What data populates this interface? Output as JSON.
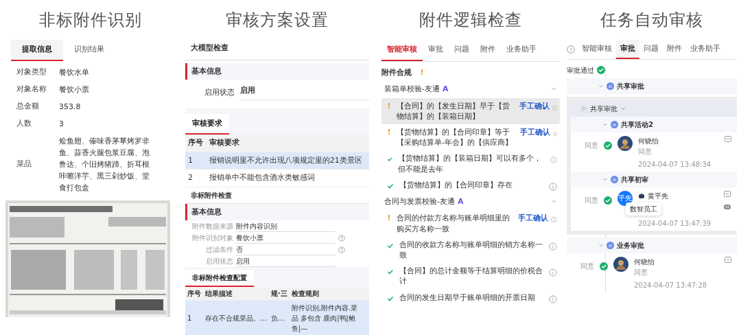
{
  "headings": [
    "非标附件识别",
    "审核方案设置",
    "附件逻辑检查",
    "任务自动审核"
  ],
  "extraction": {
    "tabs": [
      {
        "label": "提取信息",
        "selected": true
      },
      {
        "label": "识别结果",
        "selected": false
      }
    ],
    "fields": [
      {
        "label": "对象类型",
        "value": "餐饮水单"
      },
      {
        "label": "对象名称",
        "value": "餐饮小票"
      },
      {
        "label": "总金额",
        "value": "353.8"
      },
      {
        "label": "人数",
        "value": "3"
      },
      {
        "label": "菜品",
        "value": "烩鱼翅、傣味香茅草烤罗非鱼、蒜香火腿包浆豆腐、泡鲁达、个旧烤猪蹄、折耳根咔嚓洋芋、黑三剁炒饭、堂食打包盒"
      }
    ]
  },
  "scheme": {
    "title": "大模型检查",
    "section": "基本信息",
    "fields": [
      {
        "label": "启用状态",
        "value": "启用"
      }
    ],
    "tab": "审核要求",
    "columns": [
      "序号",
      "审核要求"
    ],
    "rows": [
      {
        "cells": [
          "1",
          "报销说明里不允许出现八项规定里的21类景区"
        ],
        "selected": true
      },
      {
        "cells": [
          "2",
          "报销单中不能包含酒水类敏感词"
        ],
        "selected": false
      }
    ],
    "sub_title": "非标附件检查",
    "sub_section": "基本信息",
    "sub_fields": [
      {
        "label": "附件数据来源",
        "value": "附件内容识别"
      },
      {
        "label": "附件识别对象",
        "value": "餐饮小票",
        "help": true
      },
      {
        "label": "过滤条件",
        "value": "否",
        "help": true
      },
      {
        "label": "启用状态",
        "value": "启用"
      }
    ],
    "sub_tab": "非标附件检查配置",
    "sub_columns": [
      "序号",
      "结果描述",
      "规·三",
      "检查规则"
    ],
    "sub_rows": [
      {
        "cells": [
          "1",
          "存在不合规菜品。…",
          "负…",
          "附件识别,附件内容.菜品 多包含 鹿肉|鸭|鲍鱼|—"
        ],
        "selected": true
      }
    ]
  },
  "logic": {
    "tabs": [
      {
        "label": "智能审核",
        "selected": true
      },
      {
        "label": "审批",
        "selected": false
      },
      {
        "label": "问题",
        "selected": false
      },
      {
        "label": "附件",
        "selected": false
      },
      {
        "label": "业务助手",
        "selected": false
      }
    ],
    "section": "附件合规",
    "section_mark": "!",
    "groups": [
      {
        "name": "装箱单校验-友通",
        "ai": "A",
        "items": [
          {
            "kind": "warn",
            "mark": "!",
            "text": "【合同】的【发生日期】早于【货物结算】的【装箱日期】",
            "action": "手工确认",
            "highlighted": true
          },
          {
            "kind": "warn",
            "mark": "!",
            "text": "【货物结算】的【合同印章】等于【采购结算单-年会】的【供应商】",
            "action": "手工确认",
            "highlighted": false
          },
          {
            "kind": "ok",
            "text": "【货物结算】的【装箱日期】可以有多个，但不能是去年",
            "highlighted": false
          },
          {
            "kind": "ok",
            "text": "【货物结算】的【合同印章】存在",
            "highlighted": false
          }
        ]
      },
      {
        "name": "合同与发票校验-友通",
        "ai": "A",
        "items": [
          {
            "kind": "warn",
            "mark": "!",
            "text": "合同的付款方名称与账单明细里的购买方名称一致",
            "action": "手工确认",
            "highlighted": false
          },
          {
            "kind": "ok",
            "text": "合同的收款方名称与账单明细的销方名称一致",
            "highlighted": false
          },
          {
            "kind": "ok",
            "text": "【合同】的总计金额等于结算明细的价税合计",
            "highlighted": false
          },
          {
            "kind": "ok",
            "text": "合同的发生日期早于账单明细的开票日期",
            "highlighted": false
          }
        ]
      }
    ]
  },
  "approval": {
    "tabs": [
      {
        "label": "智能审核",
        "selected": false
      },
      {
        "label": "审批",
        "selected": true
      },
      {
        "label": "问题",
        "selected": false
      },
      {
        "label": "附件",
        "selected": false
      },
      {
        "label": "业务助手",
        "selected": false
      }
    ],
    "result": "审批通过",
    "steps": [
      {
        "kind": "node",
        "title": "共享审批"
      },
      {
        "kind": "group",
        "title": "共享审批",
        "children": [
          {
            "kind": "node",
            "title": "共享活动2"
          },
          {
            "kind": "entry",
            "decision": "同意",
            "name": "何晓怡",
            "comment": "同意",
            "time": "2024-04-07 13:48:34"
          },
          {
            "kind": "node",
            "title": "共享初审"
          },
          {
            "kind": "entry",
            "decision": "同意",
            "avatar_text": "平先",
            "robot": true,
            "name": "黄平先",
            "tooltip": "数智员工",
            "time": "2024-04-07 13:47:39"
          }
        ]
      },
      {
        "kind": "node",
        "title": "业务审批"
      },
      {
        "kind": "entry",
        "decision": "同意",
        "name": "何晓怡",
        "comment": "同意",
        "time": "2024-04-07 13:47:28"
      }
    ]
  }
}
